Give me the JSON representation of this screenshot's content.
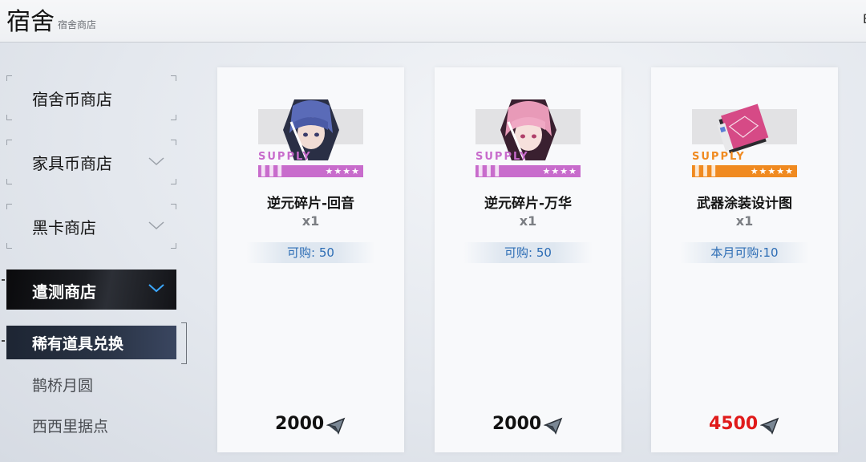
{
  "header": {
    "title": "宿舍",
    "subtitle": "宿舍商店",
    "edge_text": "E"
  },
  "sidebar": {
    "items": [
      {
        "label": "宿舍币商店",
        "has_chevron": false
      },
      {
        "label": "家具币商店",
        "has_chevron": true
      },
      {
        "label": "黑卡商店",
        "has_chevron": true
      }
    ],
    "active": {
      "label": "遣测商店",
      "icon": "chevron-down-icon"
    },
    "sub_items": [
      {
        "label": "稀有道具兑换",
        "selected": true
      },
      {
        "label": "鹊桥月圆",
        "selected": false
      },
      {
        "label": "西西里据点",
        "selected": false
      }
    ]
  },
  "cards": [
    {
      "supply": "SUPPLY",
      "stars": "★★★★",
      "name": "逆元碎片-回音",
      "qty": "x1",
      "limit": "可购: 50",
      "price": "2000",
      "accent": "#c86ccc",
      "portrait_color": "#5a6bb8",
      "price_color": "#111111"
    },
    {
      "supply": "SUPPLY",
      "stars": "★★★★",
      "name": "逆元碎片-万华",
      "qty": "x1",
      "limit": "可购: 50",
      "price": "2000",
      "accent": "#c86ccc",
      "portrait_color": "#e89ab8",
      "price_color": "#111111"
    },
    {
      "supply": "SUPPLY",
      "stars": "★★★★★",
      "name": "武器涂装设计图",
      "qty": "x1",
      "limit": "本月可购:10",
      "price": "4500",
      "accent": "#f08a20",
      "portrait_color": "#d64a86",
      "price_color": "#e01b1b"
    }
  ]
}
